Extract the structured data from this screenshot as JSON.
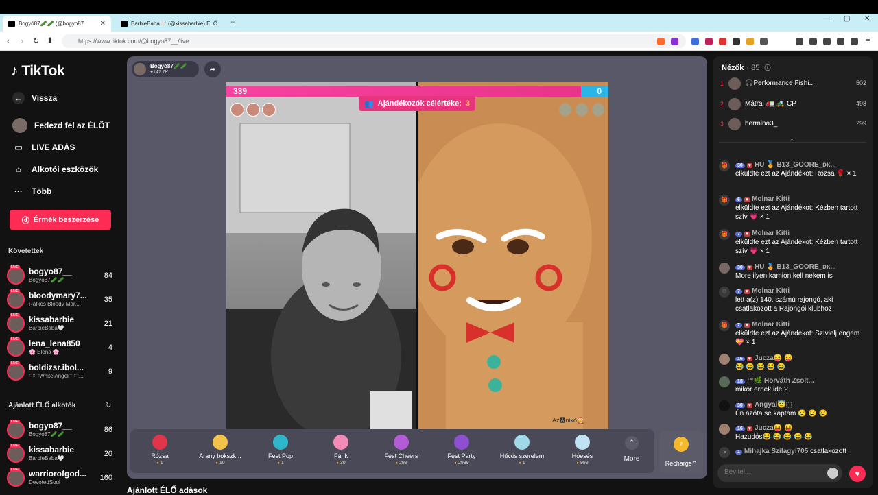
{
  "browser": {
    "tabs": [
      {
        "title": "Bogyó87🥒🥒 (@bogyo87",
        "active": true
      },
      {
        "title": "BarbieBaba🤍 (@kissabarbie) ÉLŐ",
        "active": false
      }
    ],
    "new_tab": "+",
    "url": "https://www.tiktok.com/@bogyo87__/live"
  },
  "sidebar": {
    "logo": "TikTok",
    "nav": [
      {
        "label": "Vissza",
        "icon": "back-arrow-icon"
      },
      {
        "label": "Fedezd fel az ÉLŐT",
        "icon": "avatar"
      },
      {
        "label": "LIVE ADÁS",
        "icon": "video-camera-icon"
      },
      {
        "label": "Alkotói eszközök",
        "icon": "lightbulb-icon"
      },
      {
        "label": "Több",
        "icon": "more-dots-icon"
      }
    ],
    "coin_button": "Érmék beszerzése",
    "following_header": "Követettek",
    "following": [
      {
        "name": "bogyo87__",
        "sub": "Bogyó87🥒🥒",
        "count": "84"
      },
      {
        "name": "bloodymary7...",
        "sub": "Rafkós Bloody Mar...",
        "count": "35"
      },
      {
        "name": "kissabarbie",
        "sub": "BarbieBaba🤍",
        "count": "21"
      },
      {
        "name": "lena_lena850",
        "sub": "🌸 Elena 🌸",
        "count": "4"
      },
      {
        "name": "boldizsr.ibol...",
        "sub": "⬚⬚White Angel⬚⬚...",
        "count": "9"
      }
    ],
    "suggested_header": "Ajánlott ÉLŐ alkotók",
    "suggested": [
      {
        "name": "bogyo87__",
        "sub": "Bogyó87🥒🥒",
        "count": "86"
      },
      {
        "name": "kissabarbie",
        "sub": "BarbieBaba🤍",
        "count": "20"
      },
      {
        "name": "warriorofgod...",
        "sub": "DevotedSoul",
        "count": "160"
      }
    ]
  },
  "stream": {
    "host_name": "Bogyó87🥒🥒",
    "host_likes": "♥147.7K",
    "score_left": "339",
    "score_right": "0",
    "goal_label": "Ajándékozók célértéke:",
    "goal_count": "3",
    "opponent_tag": "Az🅰nikó🤶"
  },
  "gifts": [
    {
      "name": "Rózsa",
      "price": "1",
      "color": "#e0354a"
    },
    {
      "name": "Arany bokszk...",
      "price": "10",
      "color": "#f3c24a"
    },
    {
      "name": "Fest Pop",
      "price": "1",
      "color": "#2fb7c9"
    },
    {
      "name": "Fánk",
      "price": "30",
      "color": "#f28bb5"
    },
    {
      "name": "Fest Cheers",
      "price": "299",
      "color": "#b45bd6"
    },
    {
      "name": "Fest Party",
      "price": "2999",
      "color": "#8e4fd1"
    },
    {
      "name": "Hűvös szerelem",
      "price": "1",
      "color": "#9fd8e8"
    },
    {
      "name": "Hóesés",
      "price": "999",
      "color": "#bfe3f5"
    }
  ],
  "more_label": "More",
  "recharge_label": "Recharge⌃",
  "recommended_section": "Ajánlott ÉLŐ adások",
  "viewers": {
    "title": "Nézők",
    "count": "· 85",
    "top": [
      {
        "rank": "1",
        "name": "🎧Performance Fishi...",
        "score": "502"
      },
      {
        "rank": "2",
        "name": "Mátrai 🚛 🚜 CP",
        "score": "498"
      },
      {
        "rank": "3",
        "name": "hermina3_",
        "score": "299"
      }
    ]
  },
  "chat": [
    {
      "icon": "🎁",
      "level": "30",
      "name": "HU 🏅 B13_GOORE_ᴅᴋ...",
      "text": "elküldte ezt az Ajándékot: Rózsa 🌹 × 1"
    },
    {
      "icon": "🎁",
      "level": "6",
      "name": "Molnar Kitti",
      "text": "elküldte ezt az Ajándékot: Kézben tartott szív 💗 × 1"
    },
    {
      "icon": "🎁",
      "level": "7",
      "name": "Molnar Kitti",
      "text": "elküldte ezt az Ajándékot: Kézben tartott szív 💗 × 1"
    },
    {
      "icon": "",
      "level": "30",
      "name": "HU 🏅 B13_GOORE_ᴅᴋ...",
      "text": "More ilyen kamion kell nekem is"
    },
    {
      "icon": "♡",
      "level": "7",
      "name": "Molnar Kitti",
      "text": "lett a(z) 140. számú rajongó, aki csatlakozott a Rajongói klubhoz"
    },
    {
      "icon": "🎁",
      "level": "7",
      "name": "Molnar Kitti",
      "text": "elküldte ezt az Ajándékot: Szívlelj engem 💝 × 1"
    },
    {
      "icon": "",
      "level": "16",
      "name": "Jucza😝 😝",
      "text": "😂 😂 😂 😂 😂"
    },
    {
      "icon": "",
      "level": "18",
      "name": "™🌿 Horváth Zsolt...",
      "text": "mikor ernek ide ?"
    },
    {
      "icon": "",
      "level": "30",
      "name": "Angyal😇⬚",
      "text": "Én azóta se kaptam 😢 😢 😢"
    },
    {
      "icon": "",
      "level": "16",
      "name": "Jucza😝 😝",
      "text": "Hazudós😂 😂 😂 😂 😂"
    },
    {
      "icon": "⇥",
      "level": "1",
      "name": "Mihajka Szilagyi705",
      "text": "csatlakozott"
    }
  ],
  "input_placeholder": "Bevitel..."
}
